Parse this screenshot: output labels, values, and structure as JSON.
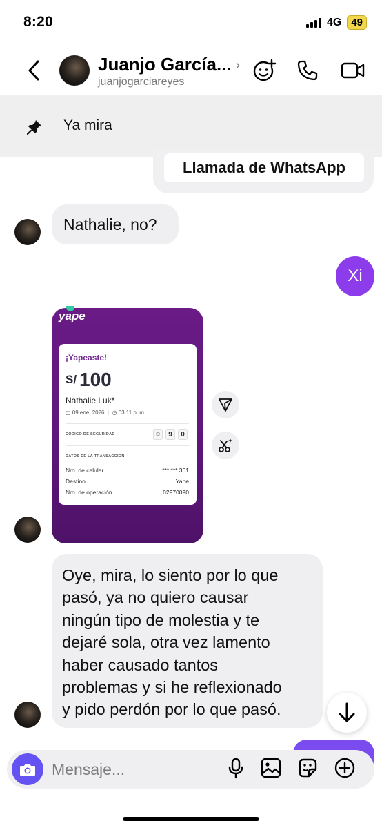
{
  "status_bar": {
    "time": "8:20",
    "network": "4G",
    "battery": "49"
  },
  "header": {
    "name": "Juanjo García...",
    "username": "juanjogarciareyes",
    "icons": [
      "back-chevron-icon",
      "effects-icon",
      "phone-icon",
      "video-icon"
    ]
  },
  "pinned": {
    "text": "Ya mira",
    "icon": "pin-icon"
  },
  "messages": {
    "whatsapp_call": "Llamada de WhatsApp",
    "msg1": "Nathalie, no?",
    "msg_out": "Xi",
    "yape": {
      "logo": "yape",
      "title": "¡Yapeaste!",
      "currency": "S/",
      "amount": "100",
      "recipient": "Nathalie Luk*",
      "date": "09 ene. 2026",
      "time": "03:11 p. m.",
      "security_label": "CÓDIGO DE SEGURIDAD",
      "security_digits": [
        "0",
        "9",
        "0"
      ],
      "tx_label": "DATOS DE LA TRANSACCIÓN",
      "rows": [
        {
          "label": "Nro. de celular",
          "value": "*** *** 361"
        },
        {
          "label": "Destino",
          "value": "Yape"
        },
        {
          "label": "Nro. de operación",
          "value": "02970090"
        }
      ]
    },
    "msg3_lines": [
      "Oye, mira, lo siento por lo que",
      "pasó, ya no quiero causar",
      "ningún tipo de molestia y te",
      "dejaré sola, otra vez lamento",
      "haber causado tantos",
      "problemas y si he reflexionado",
      "y pido perdón por lo que pasó."
    ]
  },
  "composer": {
    "placeholder": "Mensaje...",
    "icons": [
      "camera-icon",
      "microphone-icon",
      "gallery-icon",
      "sticker-icon",
      "plus-icon"
    ]
  },
  "colors": {
    "accent": "#8d3ceb",
    "camera": "#6552f2",
    "yape": "#5c167a"
  }
}
